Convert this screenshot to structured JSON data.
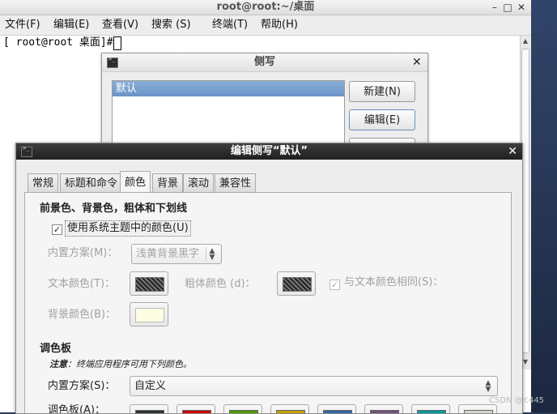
{
  "terminal": {
    "title": "root@root:~/桌面",
    "controls": {
      "minimize": "–",
      "maximize": "□",
      "close": "✕"
    },
    "menu": [
      "文件(F)",
      "编辑(E)",
      "查看(V)",
      "搜索 (S)",
      "终端(T)",
      "帮助(H)"
    ],
    "prompt": "[ root@root 桌面]# "
  },
  "profiles_dialog": {
    "title": "侧写",
    "close": "✕",
    "items": [
      "默认"
    ],
    "buttons": {
      "new": "新建(N)",
      "edit": "编辑(E)"
    }
  },
  "edit_dialog": {
    "title": "编辑侧写“默认”",
    "close": "✕",
    "tabs": [
      "常规",
      "标题和命令",
      "颜色",
      "背景",
      "滚动",
      "兼容性"
    ],
    "active_tab": "颜色",
    "section_fg": "前景色、背景色，粗体和下划线",
    "use_system_colors": {
      "label": "使用系统主题中的颜色(U)",
      "checked": true
    },
    "builtin_scheme": {
      "label": "内置方案(M)：",
      "value": "浅黄背景黑字"
    },
    "text_color_label": "文本颜色(T)：",
    "bold_color_label": "粗体颜色 (d)：",
    "same_as_text": {
      "label": "与文本颜色相同(S)：",
      "checked": true
    },
    "bg_color_label": "背景颜色(B)：",
    "section_palette": "调色板",
    "note_prefix": "注意",
    "note": "：终端应用程序可用下列颜色。",
    "palette_scheme": {
      "label": "内置方案(S)：",
      "value": "自定义"
    },
    "palette_label": "调色板(A)：",
    "palette_colors": [
      "#2e3436",
      "#cc0000",
      "#4e9a06",
      "#c4a000",
      "#3465a4",
      "#75507b",
      "#06989a",
      "#d3d7cf"
    ]
  },
  "watermark": "CSDN @Y.445"
}
